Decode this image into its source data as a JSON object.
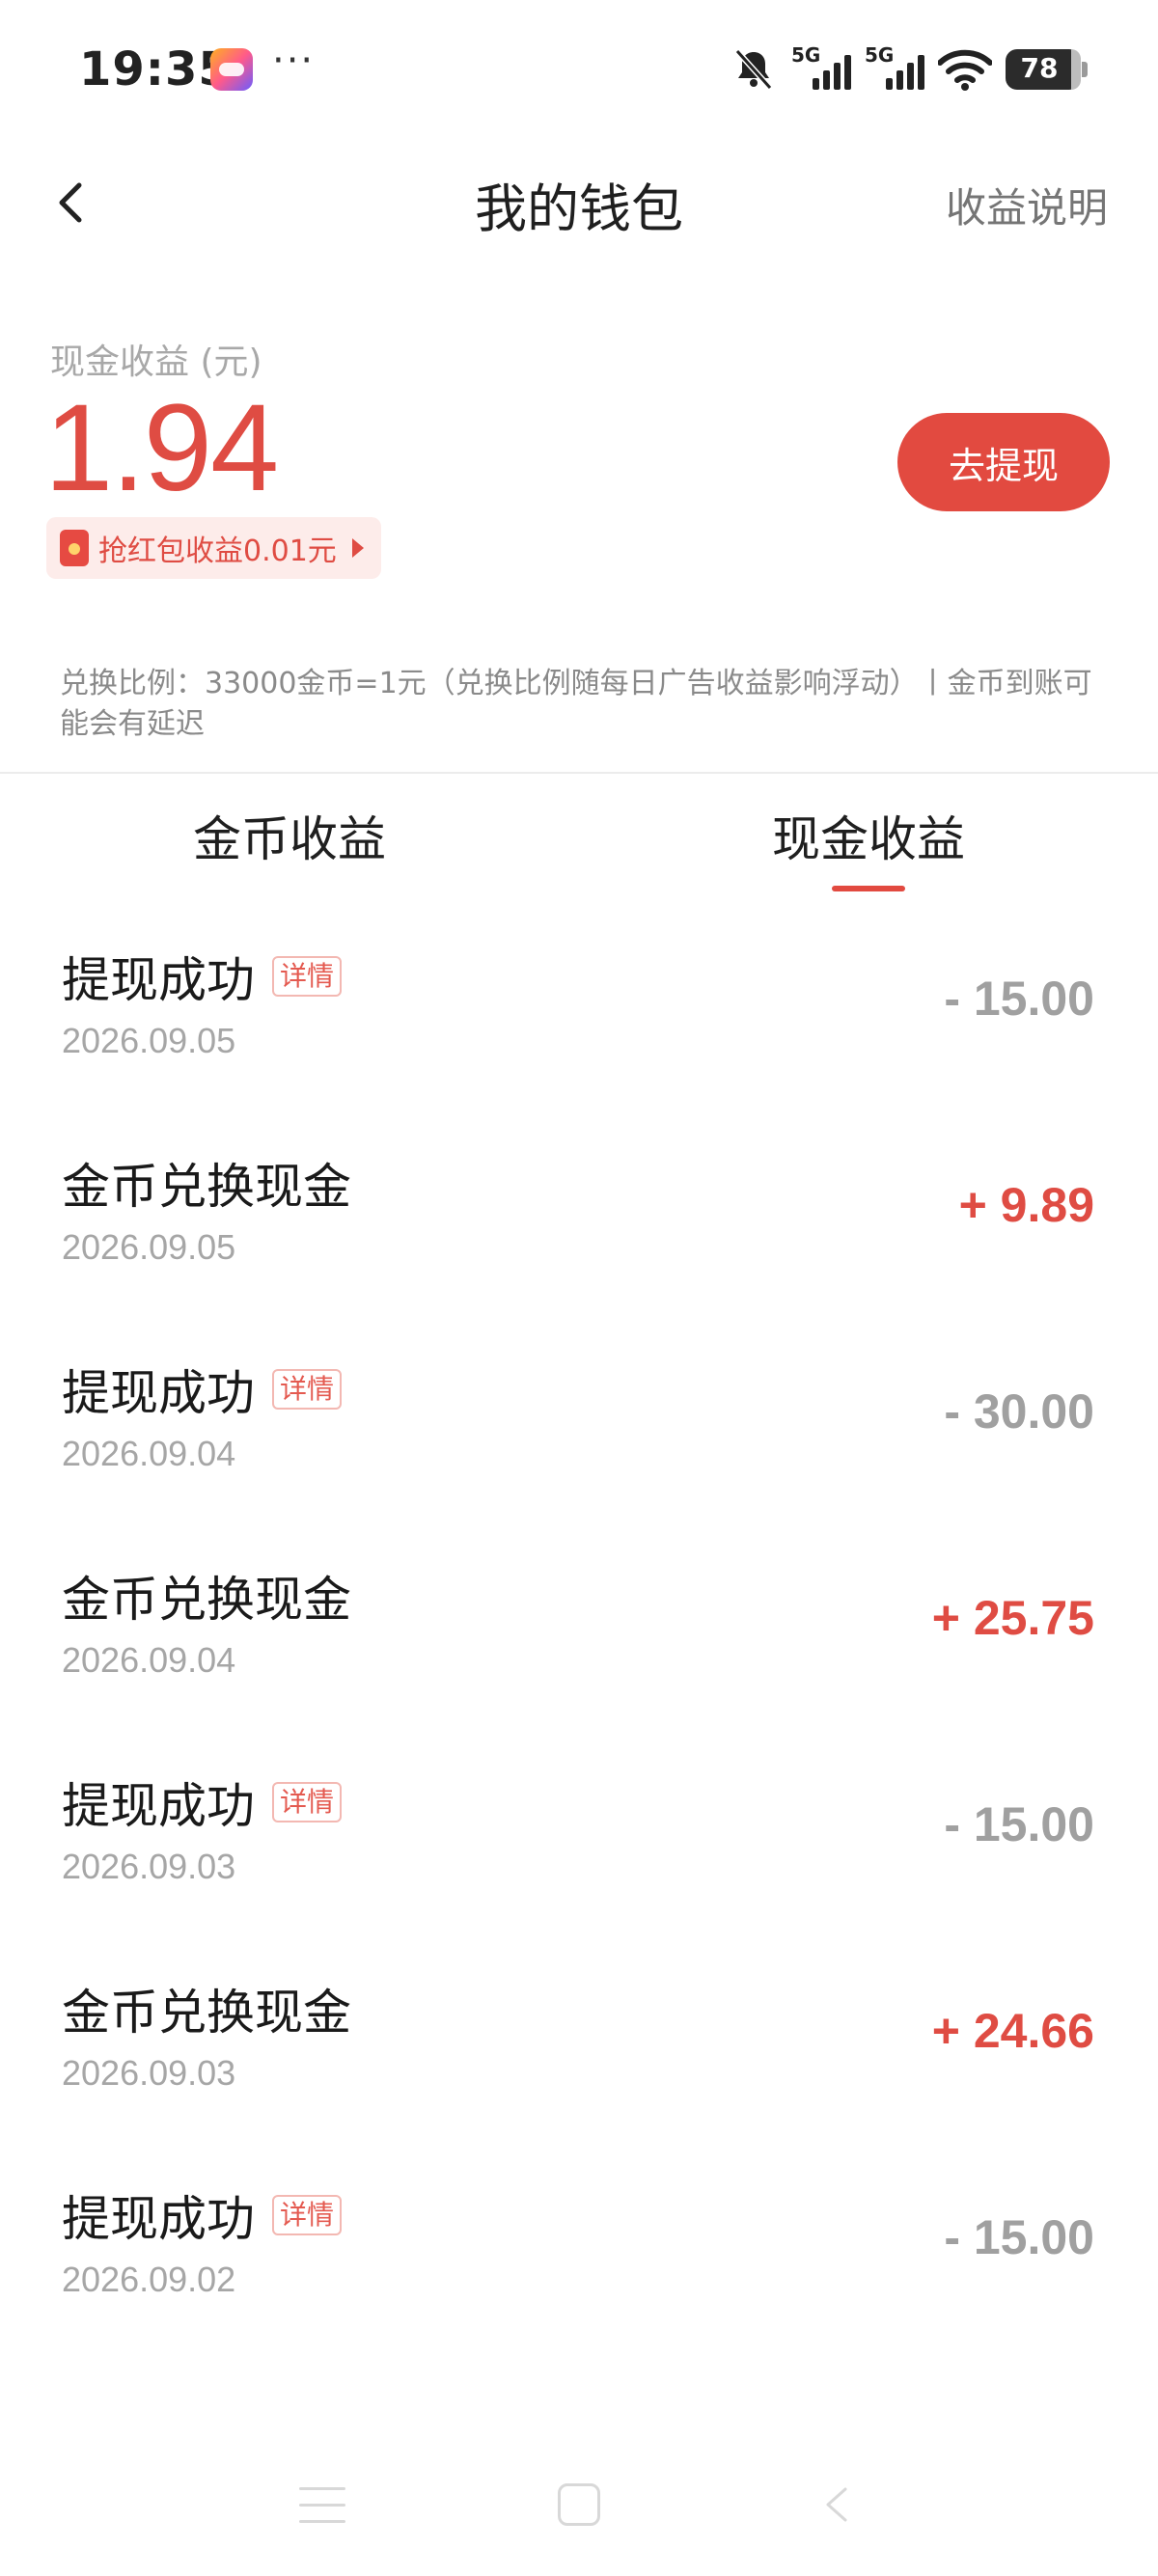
{
  "status_bar": {
    "time": "19:35",
    "app_icon": "game-center-icon",
    "more": "···",
    "signal1_label": "5G",
    "signal2_label": "5G",
    "battery": "78"
  },
  "header": {
    "title": "我的钱包",
    "right_link": "收益说明"
  },
  "balance": {
    "label": "现金收益 (元)",
    "value": "1.94",
    "red_packet_text": "抢红包收益0.01元",
    "withdraw_button": "去提现"
  },
  "notice": "兑换比例：33000金币=1元（兑换比例随每日广告收益影响浮动）丨金币到账可能会有延迟",
  "tabs": [
    {
      "label": "金币收益",
      "active": false
    },
    {
      "label": "现金收益",
      "active": true
    }
  ],
  "records": [
    {
      "title": "提现成功",
      "tag": "详情",
      "date": "2026.09.05",
      "amount": "- 15.00",
      "type": "neg"
    },
    {
      "title": "金币兑换现金",
      "tag": "",
      "date": "2026.09.05",
      "amount": "+ 9.89",
      "type": "pos"
    },
    {
      "title": "提现成功",
      "tag": "详情",
      "date": "2026.09.04",
      "amount": "- 30.00",
      "type": "neg"
    },
    {
      "title": "金币兑换现金",
      "tag": "",
      "date": "2026.09.04",
      "amount": "+ 25.75",
      "type": "pos"
    },
    {
      "title": "提现成功",
      "tag": "详情",
      "date": "2026.09.03",
      "amount": "- 15.00",
      "type": "neg"
    },
    {
      "title": "金币兑换现金",
      "tag": "",
      "date": "2026.09.03",
      "amount": "+ 24.66",
      "type": "pos"
    },
    {
      "title": "提现成功",
      "tag": "详情",
      "date": "2026.09.02",
      "amount": "- 15.00",
      "type": "neg"
    }
  ],
  "colors": {
    "accent": "#e24a40",
    "negative_amount": "#a0a0a0",
    "secondary_text": "#a6a6a6"
  }
}
